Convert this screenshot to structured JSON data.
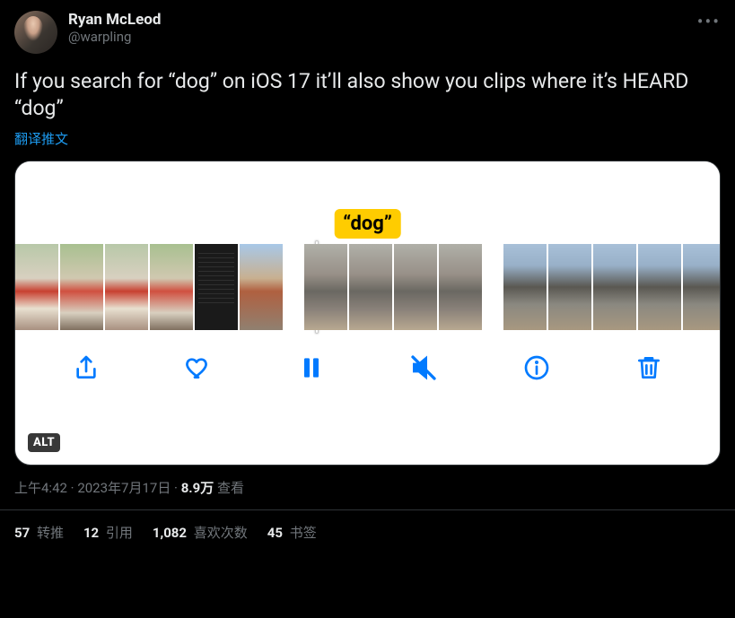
{
  "user": {
    "display_name": "Ryan McLeod",
    "handle": "@warpling"
  },
  "tweet_text": "If you search for “dog” on iOS 17 it’ll also show you clips where it’s HEARD “dog”",
  "translate_label": "翻译推文",
  "media": {
    "caption_label": "“dog”",
    "alt_badge": "ALT",
    "toolbar_icons": {
      "share": "share-icon",
      "like": "heart-icon",
      "pause": "pause-icon",
      "mute": "mute-icon",
      "info": "info-icon",
      "trash": "trash-icon"
    }
  },
  "meta": {
    "time": "上午4:42",
    "sep": " · ",
    "date": "2023年7月17日",
    "views_count": "8.9万",
    "views_label": " 查看"
  },
  "stats": {
    "retweets": {
      "count": "57",
      "label": " 转推"
    },
    "quotes": {
      "count": "12",
      "label": " 引用"
    },
    "likes": {
      "count": "1,082",
      "label": " 喜欢次数"
    },
    "bookmarks": {
      "count": "45",
      "label": " 书签"
    }
  }
}
